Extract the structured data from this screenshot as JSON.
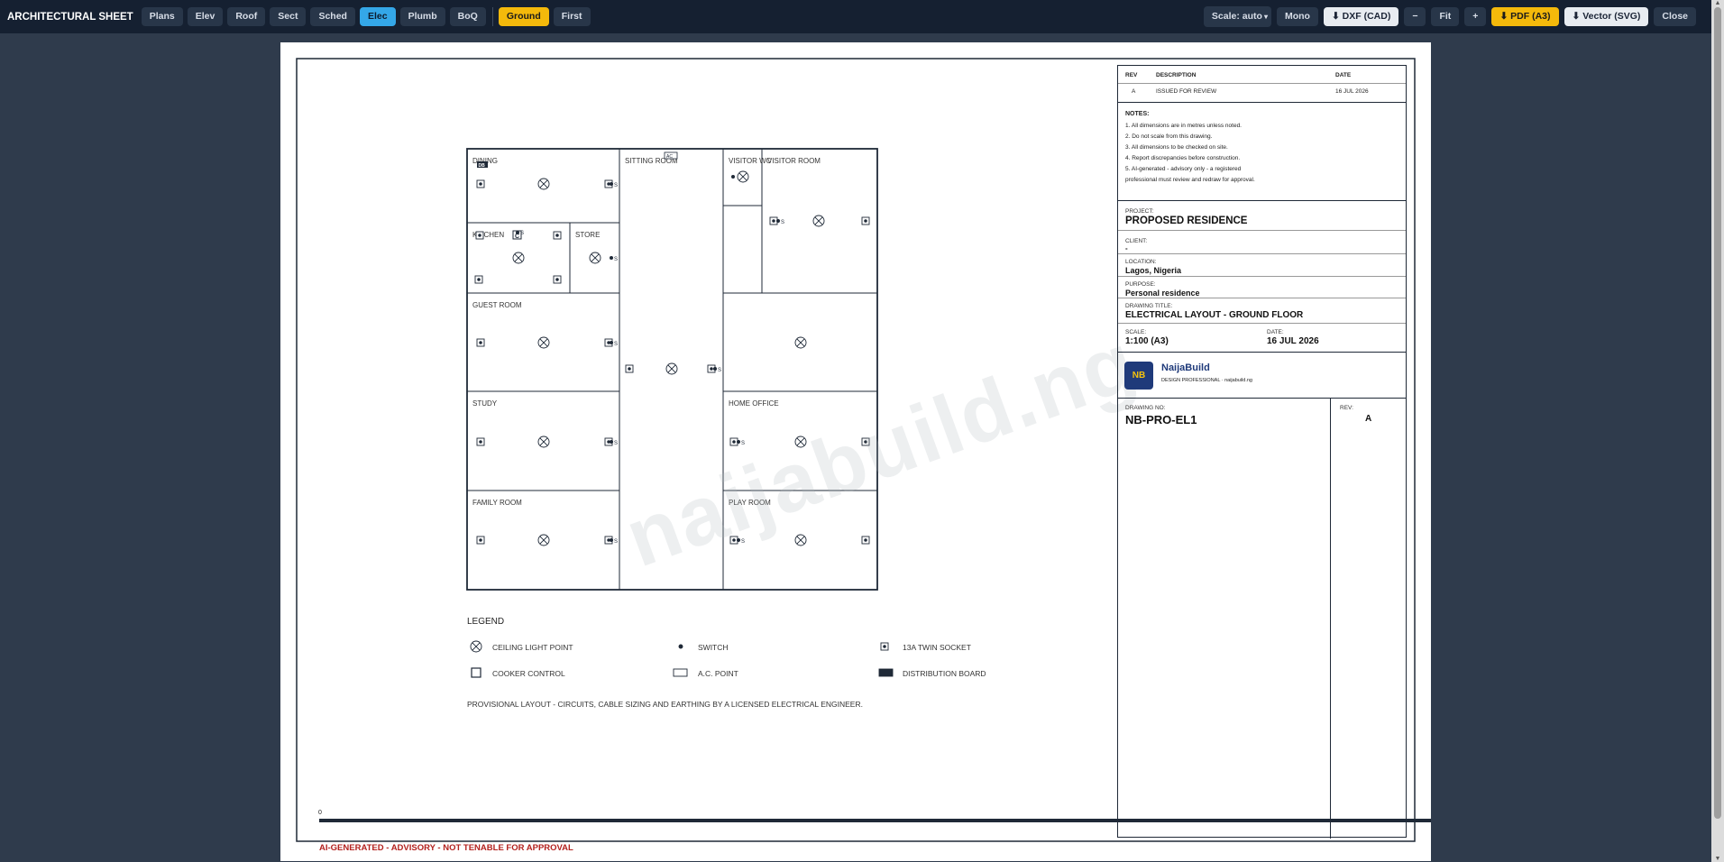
{
  "toolbar": {
    "title": "ARCHITECTURAL SHEET",
    "tabs": [
      "Plans",
      "Elev",
      "Roof",
      "Sect",
      "Sched",
      "Elec",
      "Plumb",
      "BoQ"
    ],
    "floors": [
      "Ground",
      "First"
    ],
    "scale_label": "Scale: auto",
    "mono_label": "Mono",
    "dxf_label": "⬇ DXF (CAD)",
    "zoom_out_label": "−",
    "fit_label": "Fit",
    "zoom_in_label": "+",
    "pdf_label": "⬇ PDF (A3)",
    "svg_label": "⬇ Vector (SVG)",
    "close_label": "Close"
  },
  "title_block": {
    "rev_header": "REV",
    "desc_header": "DESCRIPTION",
    "date_header": "DATE",
    "rev_row": {
      "rev": "A",
      "description": "ISSUED FOR REVIEW",
      "date": "16 JUL 2026"
    },
    "notes_title": "NOTES:",
    "notes": [
      "1. All dimensions are in metres unless noted.",
      "2. Do not scale from this drawing.",
      "3. All dimensions to be checked on site.",
      "4. Report discrepancies before construction.",
      "5. AI-generated - advisory only - a registered",
      "professional must review and redraw for approval."
    ],
    "project_label": "PROJECT:",
    "project": "PROPOSED RESIDENCE",
    "client_label": "CLIENT:",
    "client": "-",
    "location_label": "LOCATION:",
    "location": "Lagos, Nigeria",
    "purpose_label": "PURPOSE:",
    "purpose": "Personal residence",
    "drawing_title_label": "DRAWING TITLE:",
    "drawing_title": "ELECTRICAL LAYOUT - GROUND FLOOR",
    "scale_label": "SCALE:",
    "scale": "1:100 (A3)",
    "date_label": "DATE:",
    "date": "16 JUL 2026",
    "logo_text": "NB",
    "brand": "NaijaBuild",
    "brand_sub": "DESIGN PROFESSIONAL · naijabuild.ng",
    "drawing_no_label": "DRAWING NO:",
    "drawing_no": "NB-PRO-EL1",
    "rev_label": "REV:",
    "rev": "A"
  },
  "plan": {
    "rooms": [
      "DINING",
      "SITTING ROOM",
      "VISITOR WC",
      "VISITOR ROOM",
      "KITCHEN",
      "STORE",
      "GUEST ROOM",
      "STUDY",
      "HOME OFFICE",
      "FAMILY ROOM",
      "PLAY ROOM"
    ],
    "switch_letter": "S",
    "db_tag": "DB",
    "ac_tag": "AC",
    "cooker_tag": "C"
  },
  "legend": {
    "title": "LEGEND",
    "items": [
      "CEILING LIGHT POINT",
      "SWITCH",
      "13A TWIN SOCKET",
      "COOKER CONTROL",
      "A.C. POINT",
      "DISTRIBUTION BOARD"
    ],
    "note": "PROVISIONAL LAYOUT - CIRCUITS, CABLE SIZING AND EARTHING BY A LICENSED ELECTRICAL ENGINEER."
  },
  "scale_bar_zero": "0",
  "watermark": "naijabuild.ng",
  "footer_warning": "AI-GENERATED - ADVISORY - NOT TENABLE FOR APPROVAL"
}
